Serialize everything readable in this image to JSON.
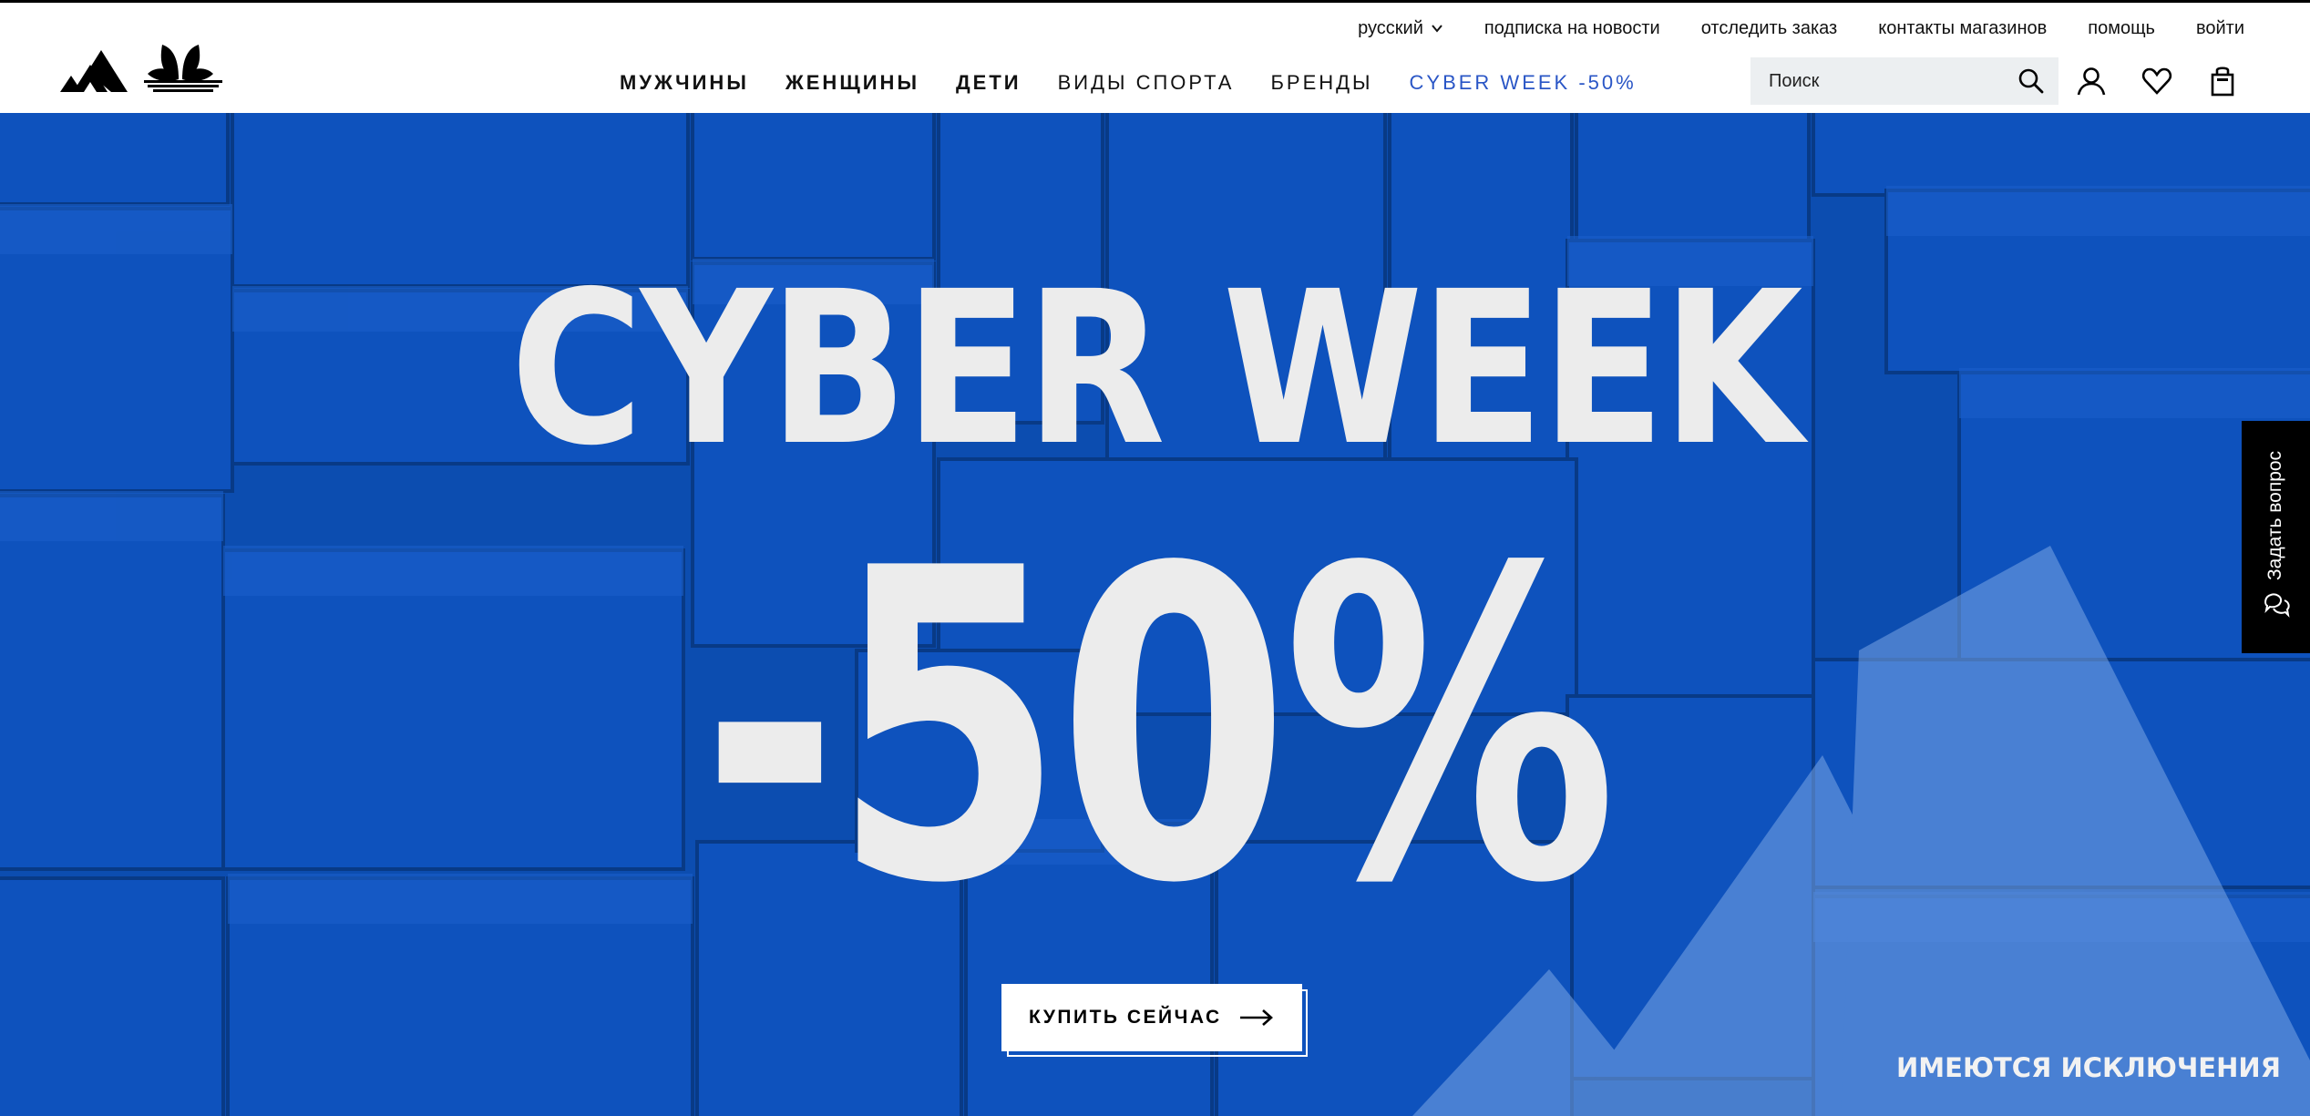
{
  "header": {
    "logo_name": "adidas-trefoil-and-stripes-logo",
    "util_nav": {
      "language": "русский",
      "links": [
        "подписка на новости",
        "отследить заказ",
        "контакты магазинов",
        "помощь",
        "войти"
      ]
    },
    "main_nav": [
      {
        "label": "МУЖЧИНЫ",
        "style": "bold"
      },
      {
        "label": "ЖЕНЩИНЫ",
        "style": "bold"
      },
      {
        "label": "ДЕТИ",
        "style": "bold"
      },
      {
        "label": "ВИДЫ СПОРТА",
        "style": "regular"
      },
      {
        "label": "БРЕНДЫ",
        "style": "regular"
      },
      {
        "label": "CYBER WEEK -50%",
        "style": "accent"
      }
    ],
    "search": {
      "placeholder": "Поиск",
      "icon": "search-icon"
    },
    "icons": [
      "account-icon",
      "wishlist-heart-icon",
      "shopping-bag-icon"
    ]
  },
  "hero": {
    "title": "CYBER WEEK",
    "discount": "-50%",
    "cta_label": "КУПИТЬ СЕЙЧАС",
    "disclaimer": "ИМЕЮТСЯ ИСКЛЮЧЕНИЯ"
  },
  "chat": {
    "label": "Задать вопрос",
    "icon": "chat-bubbles-icon"
  },
  "colors": {
    "hero_blue": "#0b4fb5",
    "accent_link": "#2a56c6",
    "hero_text": "#ececec"
  }
}
